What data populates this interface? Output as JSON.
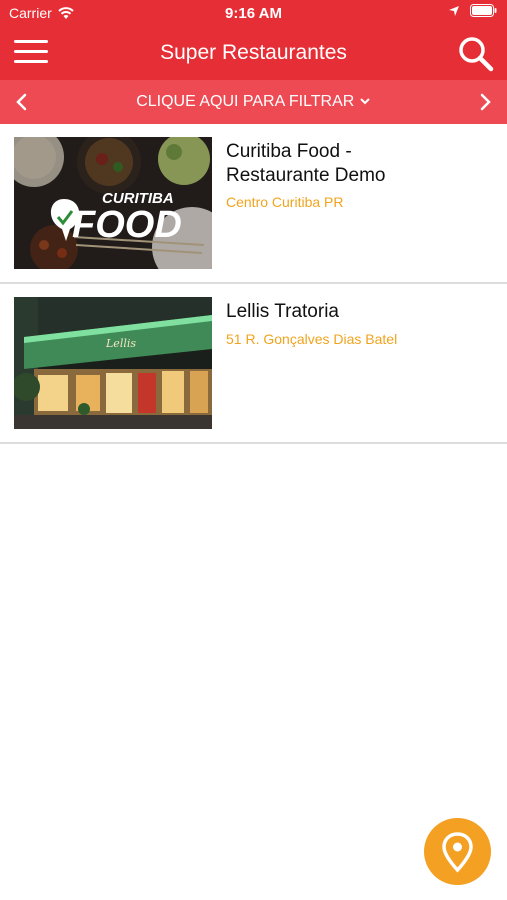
{
  "status_bar": {
    "carrier": "Carrier",
    "time": "9:16 AM"
  },
  "header": {
    "title": "Super Restaurantes"
  },
  "filter": {
    "label": "CLIQUE AQUI PARA FILTRAR"
  },
  "restaurants": [
    {
      "name_line1": "Curitiba Food -",
      "name_line2": "Restaurante Demo",
      "address": "Centro Curitiba PR",
      "logo_text_top": "CURITIBA",
      "logo_text_bottom": "FOOD"
    },
    {
      "name_line1": "Lellis Tratoria",
      "address": "51 R. Gonçalves Dias Batel"
    }
  ],
  "colors": {
    "primary": "#e62e36",
    "filter_bar": "#ee4a53",
    "accent": "#f0a41e",
    "fab": "#f3a023"
  }
}
